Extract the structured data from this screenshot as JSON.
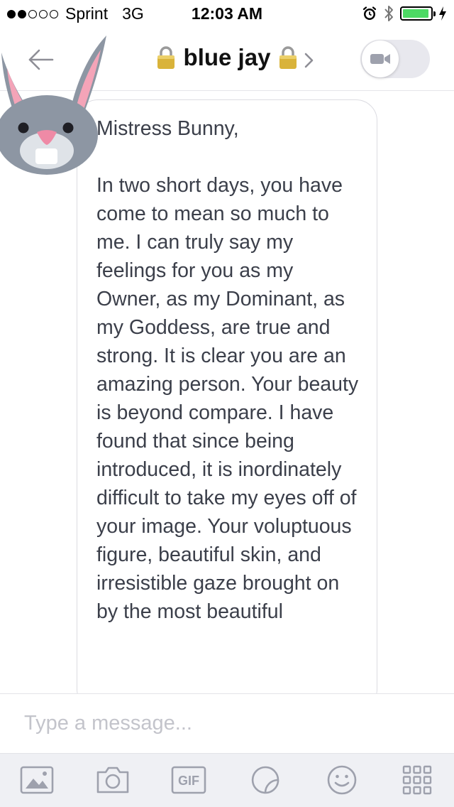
{
  "status_bar": {
    "carrier": "Sprint",
    "network": "3G",
    "time": "12:03 AM",
    "signal_bars_filled": 2,
    "signal_bars_total": 5,
    "battery_level": 0.95
  },
  "header": {
    "title": "blue jay",
    "left_lock_emoji": "🔒",
    "right_lock_emoji": "🔒"
  },
  "message": {
    "text": "Mistress Bunny,\n\nIn two short days, you have come to mean so much to me. I can truly say my feelings for you as my Owner, as my Dominant, as my Goddess, are true and strong. It is clear you are an amazing person. Your beauty is beyond compare. I have found that since being introduced, it is inordinately difficult to take my eyes off of your image. Your voluptuous figure, beautiful skin, and irresistible gaze brought on by the most beautiful"
  },
  "composer": {
    "placeholder": "Type a message...",
    "value": ""
  },
  "toolbar": {
    "gif_label": "GIF"
  },
  "icons": [
    "back-arrow-icon",
    "lock-icon",
    "chevron-right-icon",
    "video-camera-icon",
    "bunny-sticker",
    "image-icon",
    "camera-icon",
    "gif-icon",
    "sticker-icon",
    "emoji-icon",
    "grid-icon"
  ],
  "colors": {
    "battery_green": "#4cd964",
    "icon_gray": "#9ea1ad",
    "toolbar_bg": "#eff0f4",
    "message_text": "#3b3f4a"
  }
}
